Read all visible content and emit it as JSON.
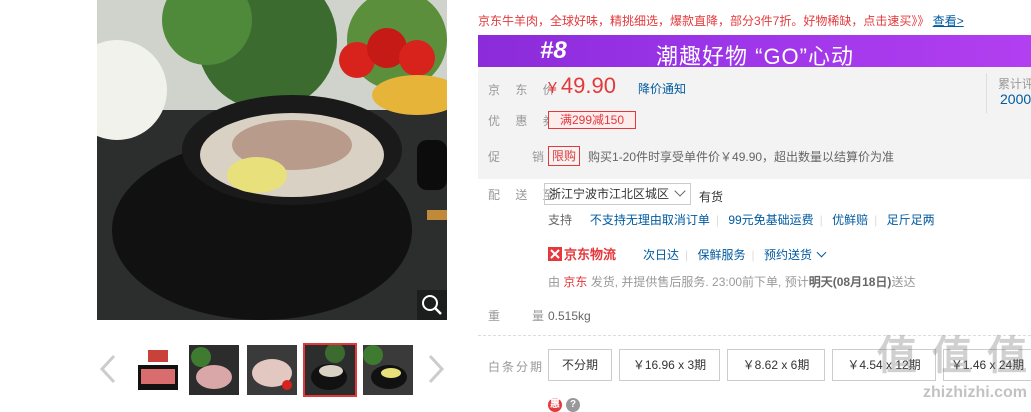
{
  "product": {
    "promo_text": "京东牛羊肉，全球好味，精挑细选，爆款直降，部分3件7折。好物稀缺，点击速买》》",
    "promo_link": "查看>",
    "banner": {
      "logo": "#8",
      "slogan": "潮趣好物 “GO”心动"
    },
    "price_label": "京 东 价",
    "currency": "¥",
    "price": "49.90",
    "price_notify": "降价通知",
    "review_label": "累计评",
    "review_count": "2000",
    "coupon_label": "优 惠 券",
    "coupon_value": "满299减150",
    "promotion_label": "促　销",
    "limit_tag": "限购",
    "promotion_text": "购买1-20件时享受单件价￥49.90，超出数量以结算价为准",
    "delivery_label": "配 送 至",
    "address": "浙江宁波市江北区城区",
    "stock": "有货",
    "support": {
      "label": "支持",
      "items": [
        "不支持无理由取消订单",
        "99元免基础运费",
        "优鲜赔",
        "足斤足两"
      ]
    },
    "jd_logistics": "京东物流",
    "services": [
      "次日达",
      "保鲜服务",
      "预约送货"
    ],
    "shipping": {
      "prefix": "由 ",
      "seller": "京东",
      "middle": " 发货, 并提供售后服务. 23:00前下单, 预计",
      "eta": "明天(08月18日)",
      "suffix": "送达"
    },
    "weight_label": "重　量",
    "weight": "0.515kg",
    "installment_label": "白条分期",
    "installments": [
      "不分期",
      "￥16.96 x 3期",
      "￥8.62 x 6期",
      "￥4.54 x 12期",
      "￥1.46 x 24期"
    ],
    "watermark": "值 值 值",
    "watermark_url": "zhizhizhi.com"
  },
  "colors": {
    "accent": "#e4393c",
    "link": "#005aa0",
    "banner": "#9b34e8"
  }
}
